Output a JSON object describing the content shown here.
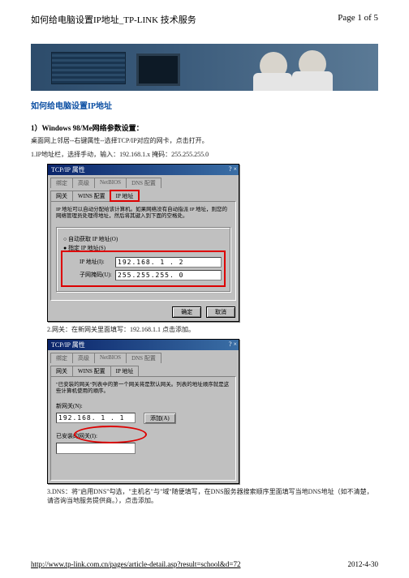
{
  "header": {
    "title": "如何给电脑设置IP地址_TP-LINK 技术服务",
    "pageinfo": "Page 1 of 5"
  },
  "article": {
    "title": "如何给电脑设置IP地址"
  },
  "section1": {
    "heading": "1）Windows 98/Me网络参数设置：",
    "line1": "桌面网上邻居--右键属性--选择TCP/IP对应的网卡，点击打开。",
    "line2": "1.IP地址栏，选择手动，输入：192.168.1.x 掩码：255.255.255.0"
  },
  "dialog1": {
    "title": "TCP/IP 属性",
    "tabs_row1": [
      "绑定",
      "高级",
      "NetBIOS",
      "DNS 配置"
    ],
    "tabs_row2": [
      "网关",
      "WINS 配置",
      "IP 地址"
    ],
    "desc": "IP 地址可以自动分配给该计算机。如果网络没有自动指派 IP 地址，则您的网络管理员处理得地址，然后将其键入到下面的空格处。",
    "radio_auto": "自动获取 IP 地址(O)",
    "radio_manual": "指定 IP 地址(S)",
    "ip_label": "IP 地址(I):",
    "ip_value": "192.168. 1 . 2",
    "mask_label": "子网掩码(U):",
    "mask_value": "255.255.255. 0",
    "ok": "确定",
    "cancel": "取消"
  },
  "section2": {
    "line": "2.网关：在新网关里面填写：192.168.1.1 点击添加。"
  },
  "dialog2": {
    "title": "TCP/IP 属性",
    "tabs_row1": [
      "绑定",
      "高级",
      "NetBIOS",
      "DNS 配置"
    ],
    "tabs_row2": [
      "网关",
      "WINS 配置",
      "IP 地址"
    ],
    "desc": "\"已安装的网关\"列表中的第一个网关将是默认网关。列表的地址顺序就是这些计算机使用的顺序。",
    "new_gw_label": "新网关(N):",
    "new_gw_value": "192.168. 1 . 1",
    "add_btn": "添加(A)",
    "installed_label": "已安装的网关(I):"
  },
  "section3": {
    "line": "3.DNS：将\"启用DNS\"勾选，\"主机名\"与\"域\"随便填写，在DNS服务器搜索顺序里面填写当地DNS地址（如不清楚，请咨询当地服务提供商。），点击添加。"
  },
  "footer": {
    "url": "http://www.tp-link.com.cn/pages/article-detail.asp?result=school&d=72",
    "date": "2012-4-30"
  }
}
